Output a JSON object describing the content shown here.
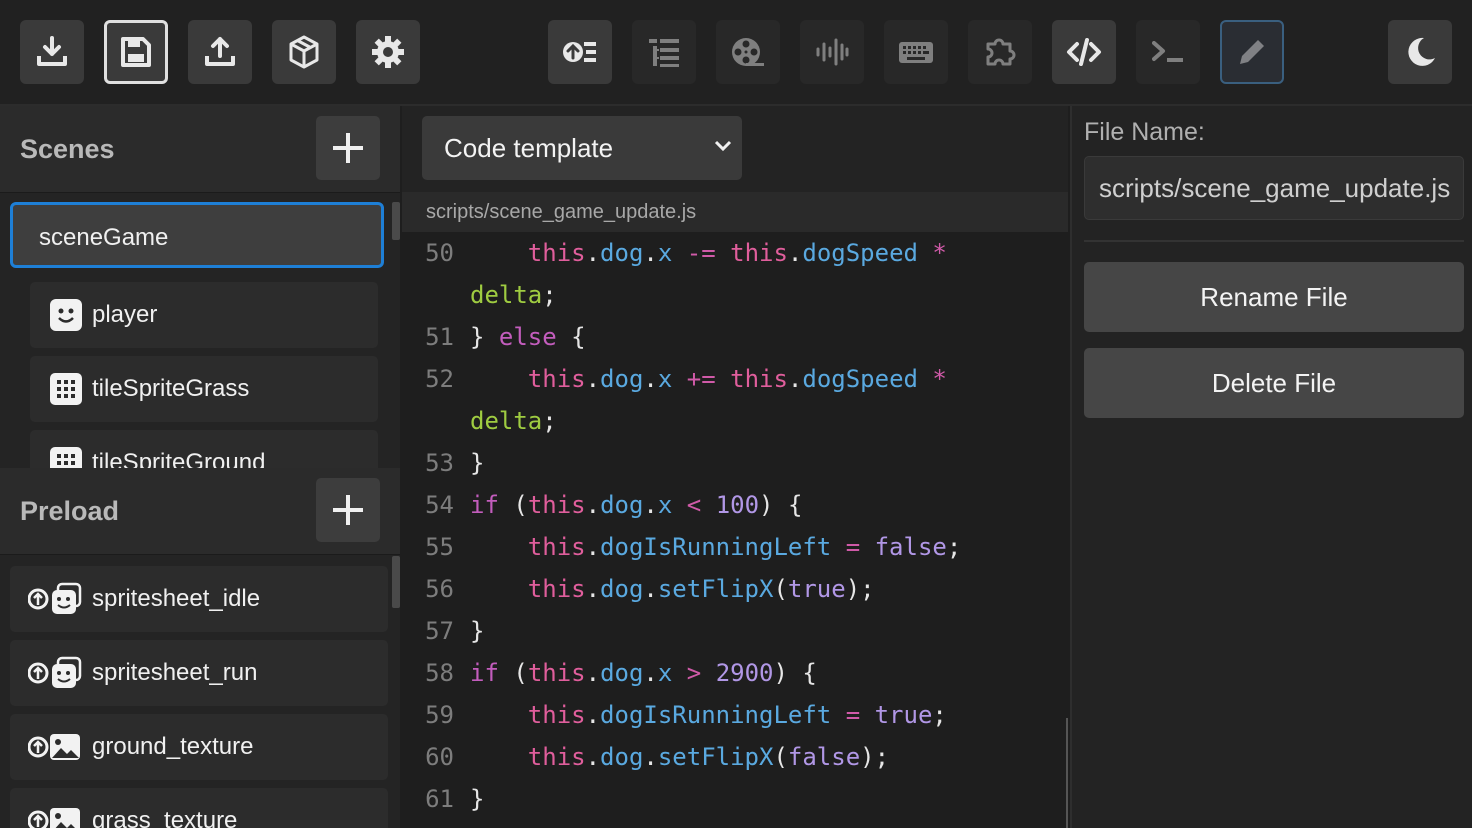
{
  "toolbar": {
    "left_icons": [
      "download-icon",
      "save-icon",
      "upload-icon",
      "cube-icon",
      "gear-icon"
    ],
    "center_icons": [
      "upload-list-icon",
      "list-icon",
      "film-reel-icon",
      "audio-wave-icon",
      "keyboard-icon",
      "puzzle-icon",
      "code-icon",
      "terminal-icon",
      "pencil-icon"
    ],
    "right_icons": [
      "moon-icon"
    ]
  },
  "scenes": {
    "title": "Scenes",
    "active_scene": "sceneGame",
    "items": [
      {
        "label": "player",
        "icon": "smiley-icon"
      },
      {
        "label": "tileSpriteGrass",
        "icon": "grid-icon"
      },
      {
        "label": "tileSpriteGround",
        "icon": "grid-icon"
      }
    ]
  },
  "preload": {
    "title": "Preload",
    "items": [
      {
        "label": "spritesheet_idle",
        "icon": "spritesheet-icon"
      },
      {
        "label": "spritesheet_run",
        "icon": "spritesheet-icon"
      },
      {
        "label": "ground_texture",
        "icon": "image-icon"
      },
      {
        "label": "grass_texture",
        "icon": "image-icon"
      }
    ]
  },
  "editor": {
    "template_select": "Code template",
    "file_path": "scripts/scene_game_update.js",
    "line_numbers": [
      "50",
      "51",
      "52",
      "53",
      "54",
      "55",
      "56",
      "57",
      "58",
      "59",
      "60",
      "61"
    ]
  },
  "file_panel": {
    "label": "File Name:",
    "file_name_value": "scripts/scene_game_update.js",
    "rename_label": "Rename File",
    "delete_label": "Delete File"
  },
  "colors": {
    "accent_border": "#1e7fd6",
    "keyword": "#c35dbd",
    "this": "#e05e9c",
    "property": "#5aa9e0",
    "variable": "#9fcc41",
    "number": "#b197e6"
  }
}
